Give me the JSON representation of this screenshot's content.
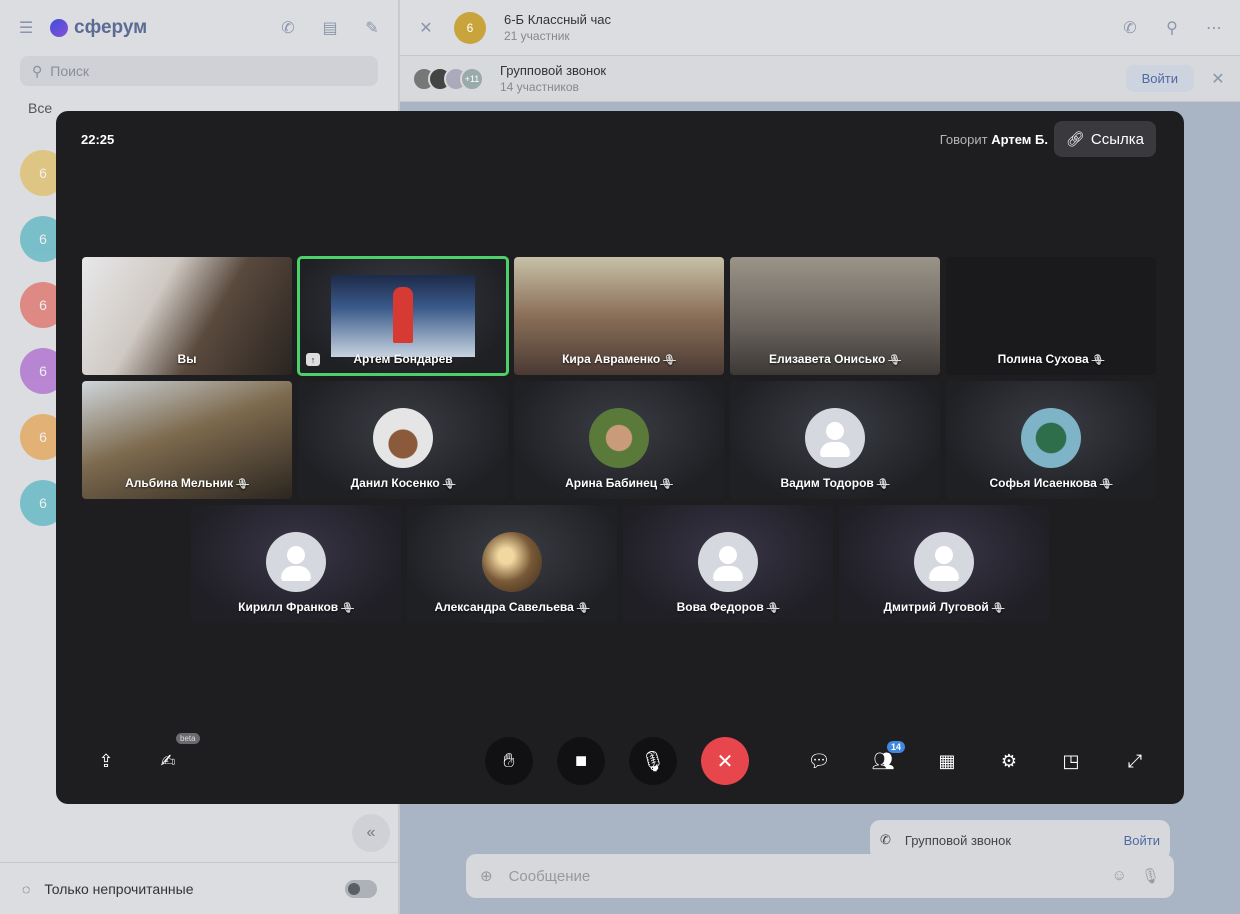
{
  "sidebar": {
    "brand": "сферум",
    "search_placeholder": "Поиск",
    "filter_all": "Все",
    "chat_avatars": [
      "6",
      "6",
      "6",
      "6",
      "6",
      "6"
    ],
    "chat_avatar_colors": [
      "#e3b23a",
      "#2aa7b8",
      "#e0453a",
      "#9b3ec8",
      "#e88e1e",
      "#2aa7b8"
    ],
    "unread_only_label": "Только непрочитанные"
  },
  "chat": {
    "avatar_text": "6",
    "title": "6-Б Классный час",
    "participants": "21 участник",
    "call_banner": {
      "title": "Групповой звонок",
      "subtitle": "14 участников",
      "more_count": "+11",
      "join_label": "Войти"
    },
    "bottom_call_card": {
      "title": "Групповой звонок",
      "join_label": "Войти"
    },
    "message_placeholder": "Сообщение"
  },
  "call": {
    "time": "22:25",
    "speaking_prefix": "Говорит",
    "speaking_name": "Артем Б.",
    "link_label": "Ссылка",
    "participants_badge": "14",
    "beta_label": "beta",
    "tiles": [
      {
        "name": "Вы",
        "kind": "video",
        "muted": false
      },
      {
        "name": "Артем Бондарев",
        "kind": "screen",
        "muted": false,
        "speaking": true
      },
      {
        "name": "Кира Авраменко",
        "kind": "video",
        "muted": true
      },
      {
        "name": "Елизавета Онисько",
        "kind": "video",
        "muted": true
      },
      {
        "name": "Полина Сухова",
        "kind": "dark",
        "muted": true
      },
      {
        "name": "Альбина Мельник",
        "kind": "video",
        "muted": true
      },
      {
        "name": "Данил Косенко",
        "kind": "photo",
        "muted": true
      },
      {
        "name": "Арина Бабинец",
        "kind": "photo",
        "muted": true
      },
      {
        "name": "Вадим Тодоров",
        "kind": "placeholder",
        "muted": true
      },
      {
        "name": "Софья Исаенкова",
        "kind": "photo",
        "muted": true
      },
      {
        "name": "Кирилл Франков",
        "kind": "placeholder",
        "muted": true
      },
      {
        "name": "Александра Савельева",
        "kind": "photo",
        "muted": true
      },
      {
        "name": "Вова Федоров",
        "kind": "placeholder",
        "muted": true
      },
      {
        "name": "Дмитрий Луговой",
        "kind": "placeholder",
        "muted": true
      }
    ]
  }
}
